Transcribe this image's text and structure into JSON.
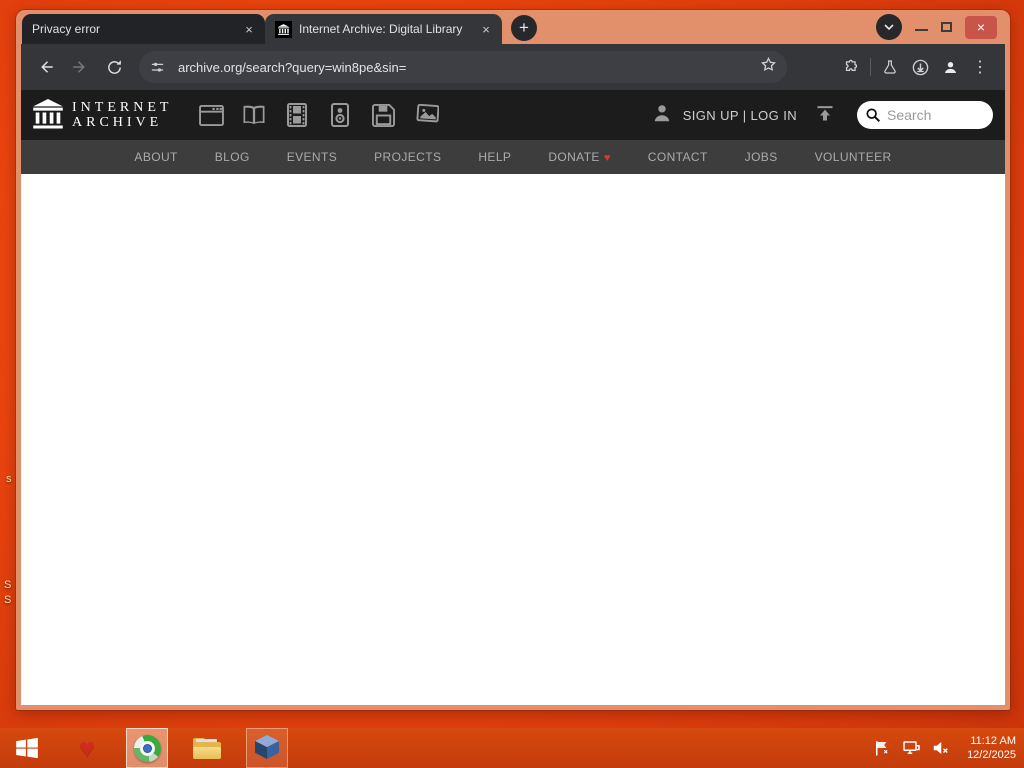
{
  "window": {
    "tabs": [
      {
        "title": "Privacy error"
      },
      {
        "title": "Internet Archive: Digital Library"
      }
    ],
    "glyphs": {
      "new_tab": "+",
      "close_tab": "×",
      "close_window": "×",
      "menu_kebab": "⋮"
    }
  },
  "toolbar": {
    "url": "archive.org/search?query=win8pe&sin="
  },
  "ia": {
    "logo_line1": "INTERNET",
    "logo_line2": "ARCHIVE",
    "auth_text": "SIGN UP | LOG IN",
    "search_placeholder": "Search",
    "nav": [
      "ABOUT",
      "BLOG",
      "EVENTS",
      "PROJECTS",
      "HELP",
      "DONATE",
      "CONTACT",
      "JOBS",
      "VOLUNTEER"
    ],
    "donate_heart": "♥"
  },
  "taskbar": {
    "time": "11:12 AM",
    "date": "12/2/2025"
  },
  "desktop": {
    "fragments": [
      "s",
      "S",
      "S"
    ]
  },
  "colors": {
    "desktop_orange": "#e8430e",
    "frame_salmon": "#e2906b",
    "tab_inactive": "#212327",
    "toolbar_dark": "#35363a",
    "ia_header": "#1c1c1c",
    "ia_nav": "#3d3d3d",
    "close_button_red": "#c9544a",
    "heart_red": "#e8332a"
  }
}
